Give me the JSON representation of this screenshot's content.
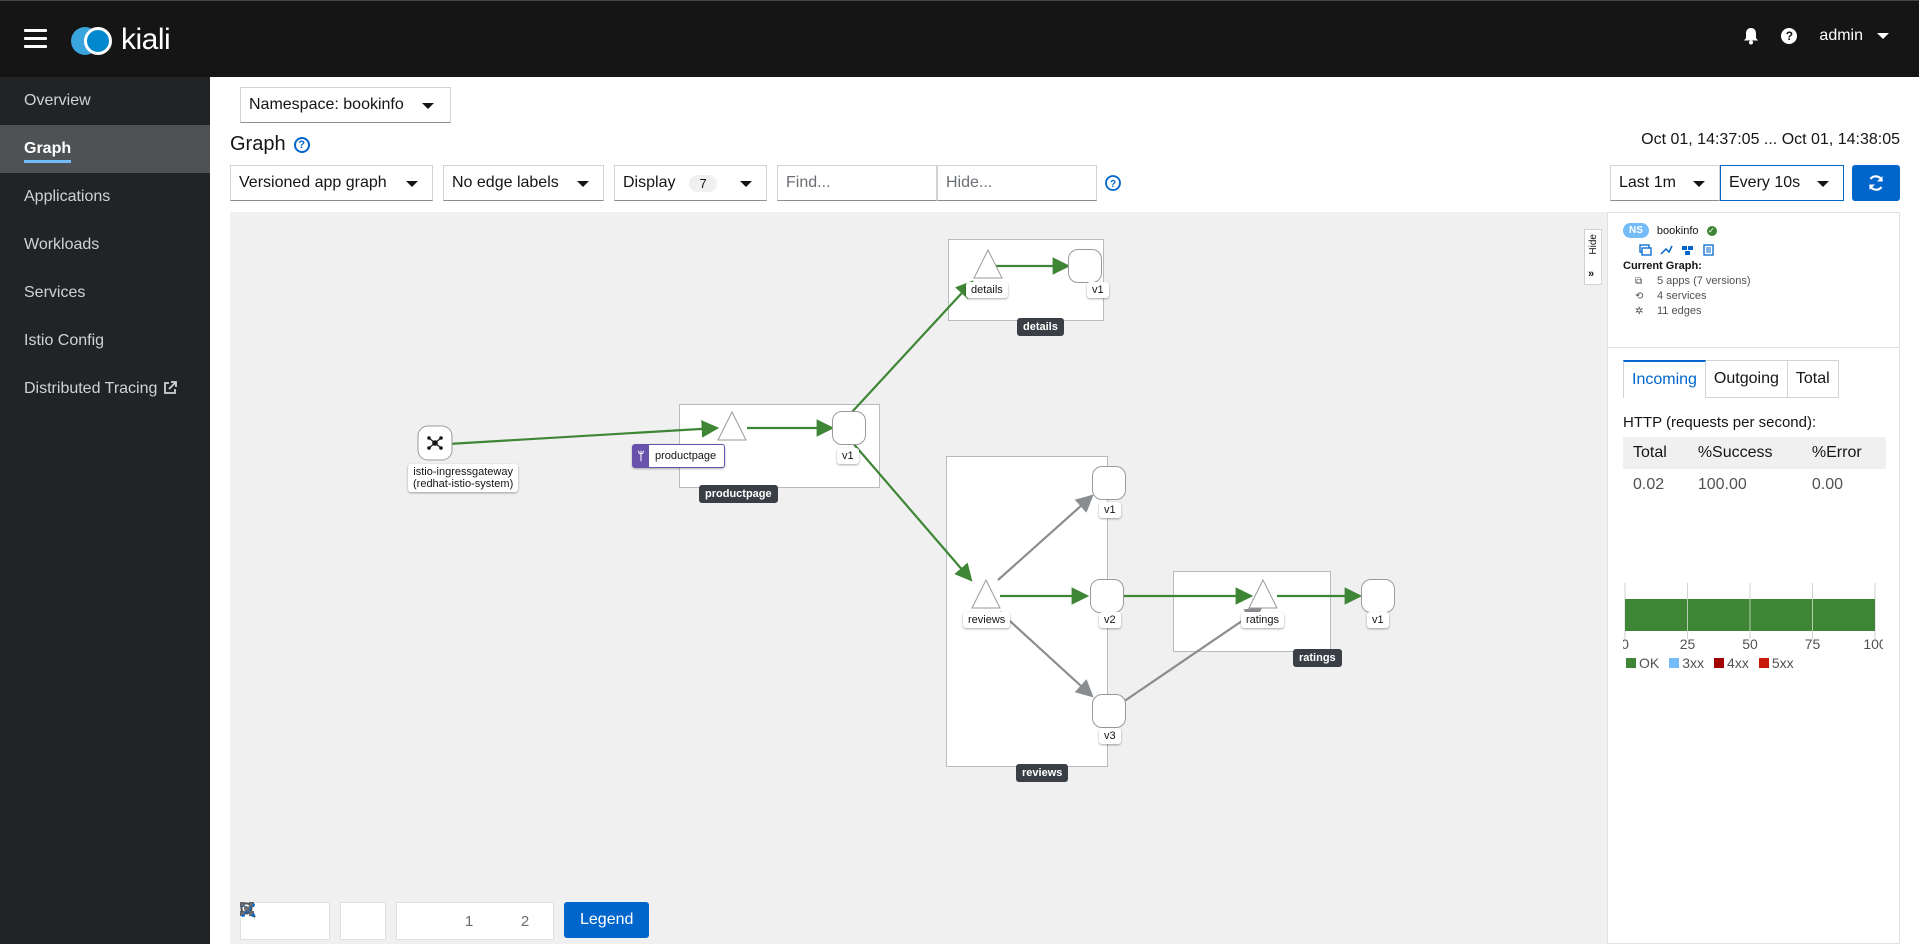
{
  "masthead": {
    "logo_text": "kiali",
    "user": "admin"
  },
  "sidebar": {
    "items": [
      {
        "label": "Overview"
      },
      {
        "label": "Graph"
      },
      {
        "label": "Applications"
      },
      {
        "label": "Workloads"
      },
      {
        "label": "Services"
      },
      {
        "label": "Istio Config"
      },
      {
        "label": "Distributed Tracing"
      }
    ]
  },
  "namespace": {
    "label": "Namespace: bookinfo"
  },
  "page": {
    "title": "Graph",
    "time_range": "Oct 01, 14:37:05 ... Oct 01, 14:38:05"
  },
  "toolbar": {
    "graph_type": "Versioned app graph",
    "edge_labels": "No edge labels",
    "display": "Display",
    "display_count": "7",
    "find_placeholder": "Find...",
    "hide_placeholder": "Hide...",
    "duration": "Last 1m",
    "refresh": "Every 10s"
  },
  "graph": {
    "boxes": {
      "details": "details",
      "productpage": "productpage",
      "reviews": "reviews",
      "ratings": "ratings"
    },
    "nodes": {
      "gateway_line1": "istio-ingressgateway",
      "gateway_line2": "(redhat-istio-system)",
      "productpage_svc": "productpage",
      "productpage_v1": "v1",
      "details_svc": "details",
      "details_v1": "v1",
      "reviews_svc": "reviews",
      "reviews_v1": "v1",
      "reviews_v2": "v2",
      "reviews_v3": "v3",
      "ratings_svc": "ratings",
      "ratings_v1": "v1"
    },
    "colors": {
      "healthy_edge": "#3e8635",
      "idle_edge": "#8a8d90"
    },
    "layout_buttons": {
      "l1": "1",
      "l2": "2"
    },
    "legend_button": "Legend",
    "hide_tab": "Hide"
  },
  "side_panel": {
    "ns_badge": "NS",
    "namespace": "bookinfo",
    "current_graph_title": "Current Graph:",
    "apps": "5 apps (7 versions)",
    "services": "4 services",
    "edges": "11 edges",
    "tabs": [
      "Incoming",
      "Outgoing",
      "Total"
    ],
    "http_title": "HTTP (requests per second):",
    "table": {
      "headers": [
        "Total",
        "%Success",
        "%Error"
      ],
      "row": [
        "0.02",
        "100.00",
        "0.00"
      ]
    },
    "chart_ticks": [
      "0",
      "25",
      "50",
      "75",
      "100"
    ],
    "chart_value_ok": 100,
    "legend": [
      {
        "label": "OK",
        "color": "#3e8635"
      },
      {
        "label": "3xx",
        "color": "#73bcf7"
      },
      {
        "label": "4xx",
        "color": "#a30000"
      },
      {
        "label": "5xx",
        "color": "#c9190b"
      }
    ]
  }
}
